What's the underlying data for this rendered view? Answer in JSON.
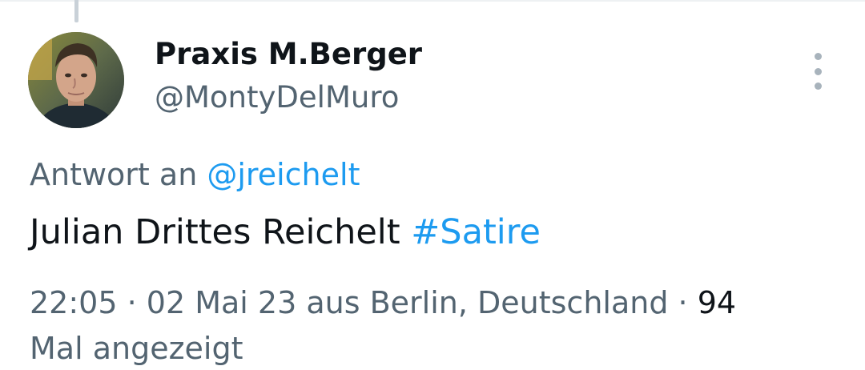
{
  "author": {
    "display_name": "Praxis M.Berger",
    "handle": "@MontyDelMuro"
  },
  "reply": {
    "prefix": "Antwort an",
    "to_handle": "@jreichelt"
  },
  "tweet": {
    "text": "Julian Drittes Reichelt",
    "hashtag": "#Satire"
  },
  "meta": {
    "time": "22:05",
    "separator": " · ",
    "date_location": "02 Mai 23 aus Berlin, Deutschland",
    "views_count": "94",
    "views_label": "Mal angezeigt"
  },
  "icons": {
    "more": "more-vertical-icon"
  },
  "colors": {
    "link": "#1d9bf0",
    "text_primary": "#0f1419",
    "text_secondary": "#536471"
  }
}
